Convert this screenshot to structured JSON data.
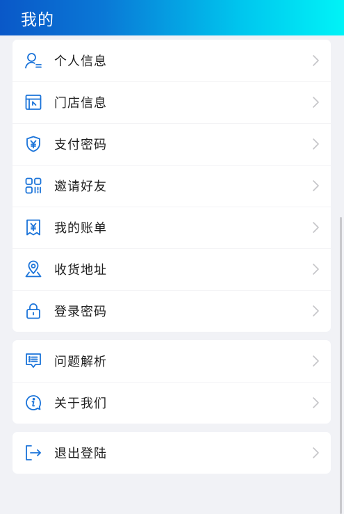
{
  "header": {
    "title": "我的",
    "gradient_start": "#0a58c8",
    "gradient_end": "#00f3f7"
  },
  "accent_color": "#1a73d9",
  "groups": [
    {
      "items": [
        {
          "label": "个人信息",
          "icon": "user-info-icon"
        },
        {
          "label": "门店信息",
          "icon": "store-icon"
        },
        {
          "label": "支付密码",
          "icon": "yuan-shield-icon"
        },
        {
          "label": "邀请好友",
          "icon": "qr-code-icon"
        },
        {
          "label": "我的账单",
          "icon": "bill-icon"
        },
        {
          "label": "收货地址",
          "icon": "location-pin-icon"
        },
        {
          "label": "登录密码",
          "icon": "lock-icon"
        }
      ]
    },
    {
      "items": [
        {
          "label": "问题解析",
          "icon": "faq-list-icon"
        },
        {
          "label": "关于我们",
          "icon": "info-icon"
        }
      ]
    },
    {
      "items": [
        {
          "label": "退出登陆",
          "icon": "logout-icon"
        }
      ]
    }
  ]
}
